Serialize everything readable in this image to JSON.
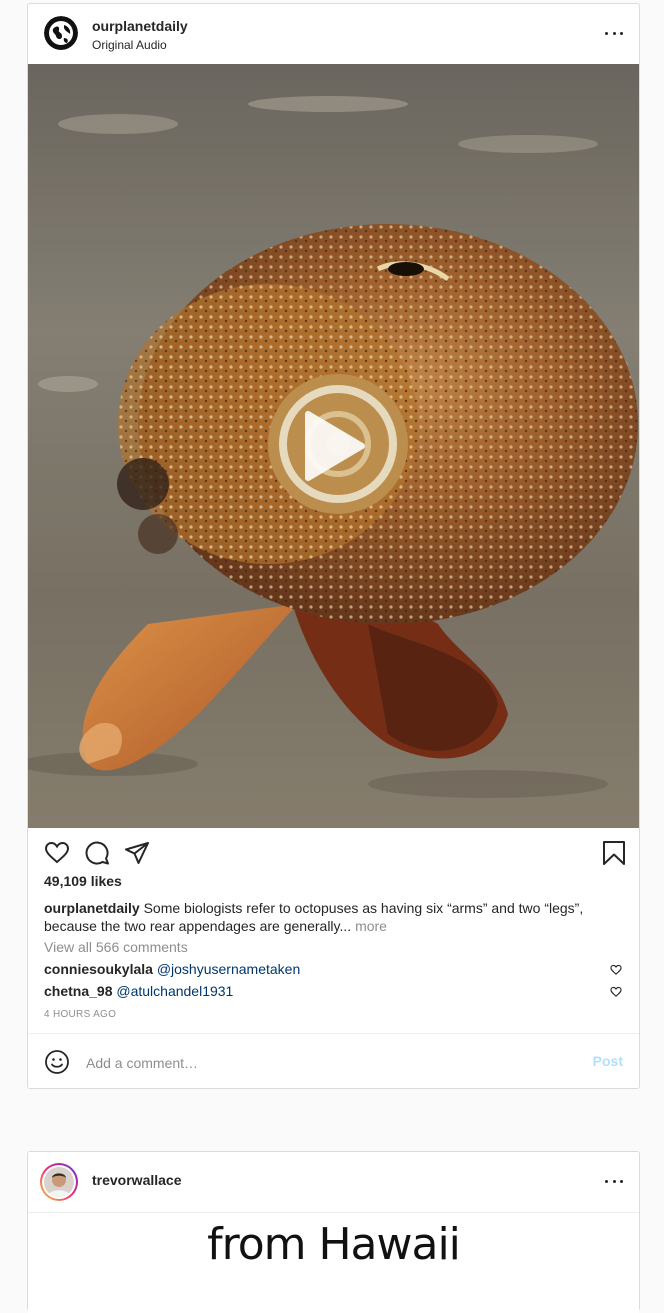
{
  "post1": {
    "username": "ourplanetdaily",
    "audio": "Original Audio",
    "likes": "49,109 likes",
    "caption_user": "ourplanetdaily",
    "caption_text": "Some biologists refer to octopuses as having six “arms” and two “legs”, because the two rear appendages are generally...",
    "caption_more": "more",
    "view_all": "View all 566 comments",
    "comments": [
      {
        "user": "conniesoukylala",
        "mention": "@joshyusernametaken"
      },
      {
        "user": "chetna_98",
        "mention": "@atulchandel1931"
      }
    ],
    "time": "4 HOURS AGO",
    "comment_placeholder": "Add a comment…",
    "post_label": "Post",
    "icons": {
      "like": "heart-icon",
      "comment": "comment-icon",
      "share": "paper-plane-icon",
      "save": "bookmark-icon",
      "emoji": "smiley-icon",
      "options": "more-options-icon",
      "play": "play-icon"
    }
  },
  "post2": {
    "username": "trevorwallace",
    "video_text": "from Hawaii"
  },
  "colors": {
    "link": "#00376b",
    "post_disabled": "#b2dffc",
    "muted": "#8e8e8e",
    "border": "#dbdbdb"
  }
}
